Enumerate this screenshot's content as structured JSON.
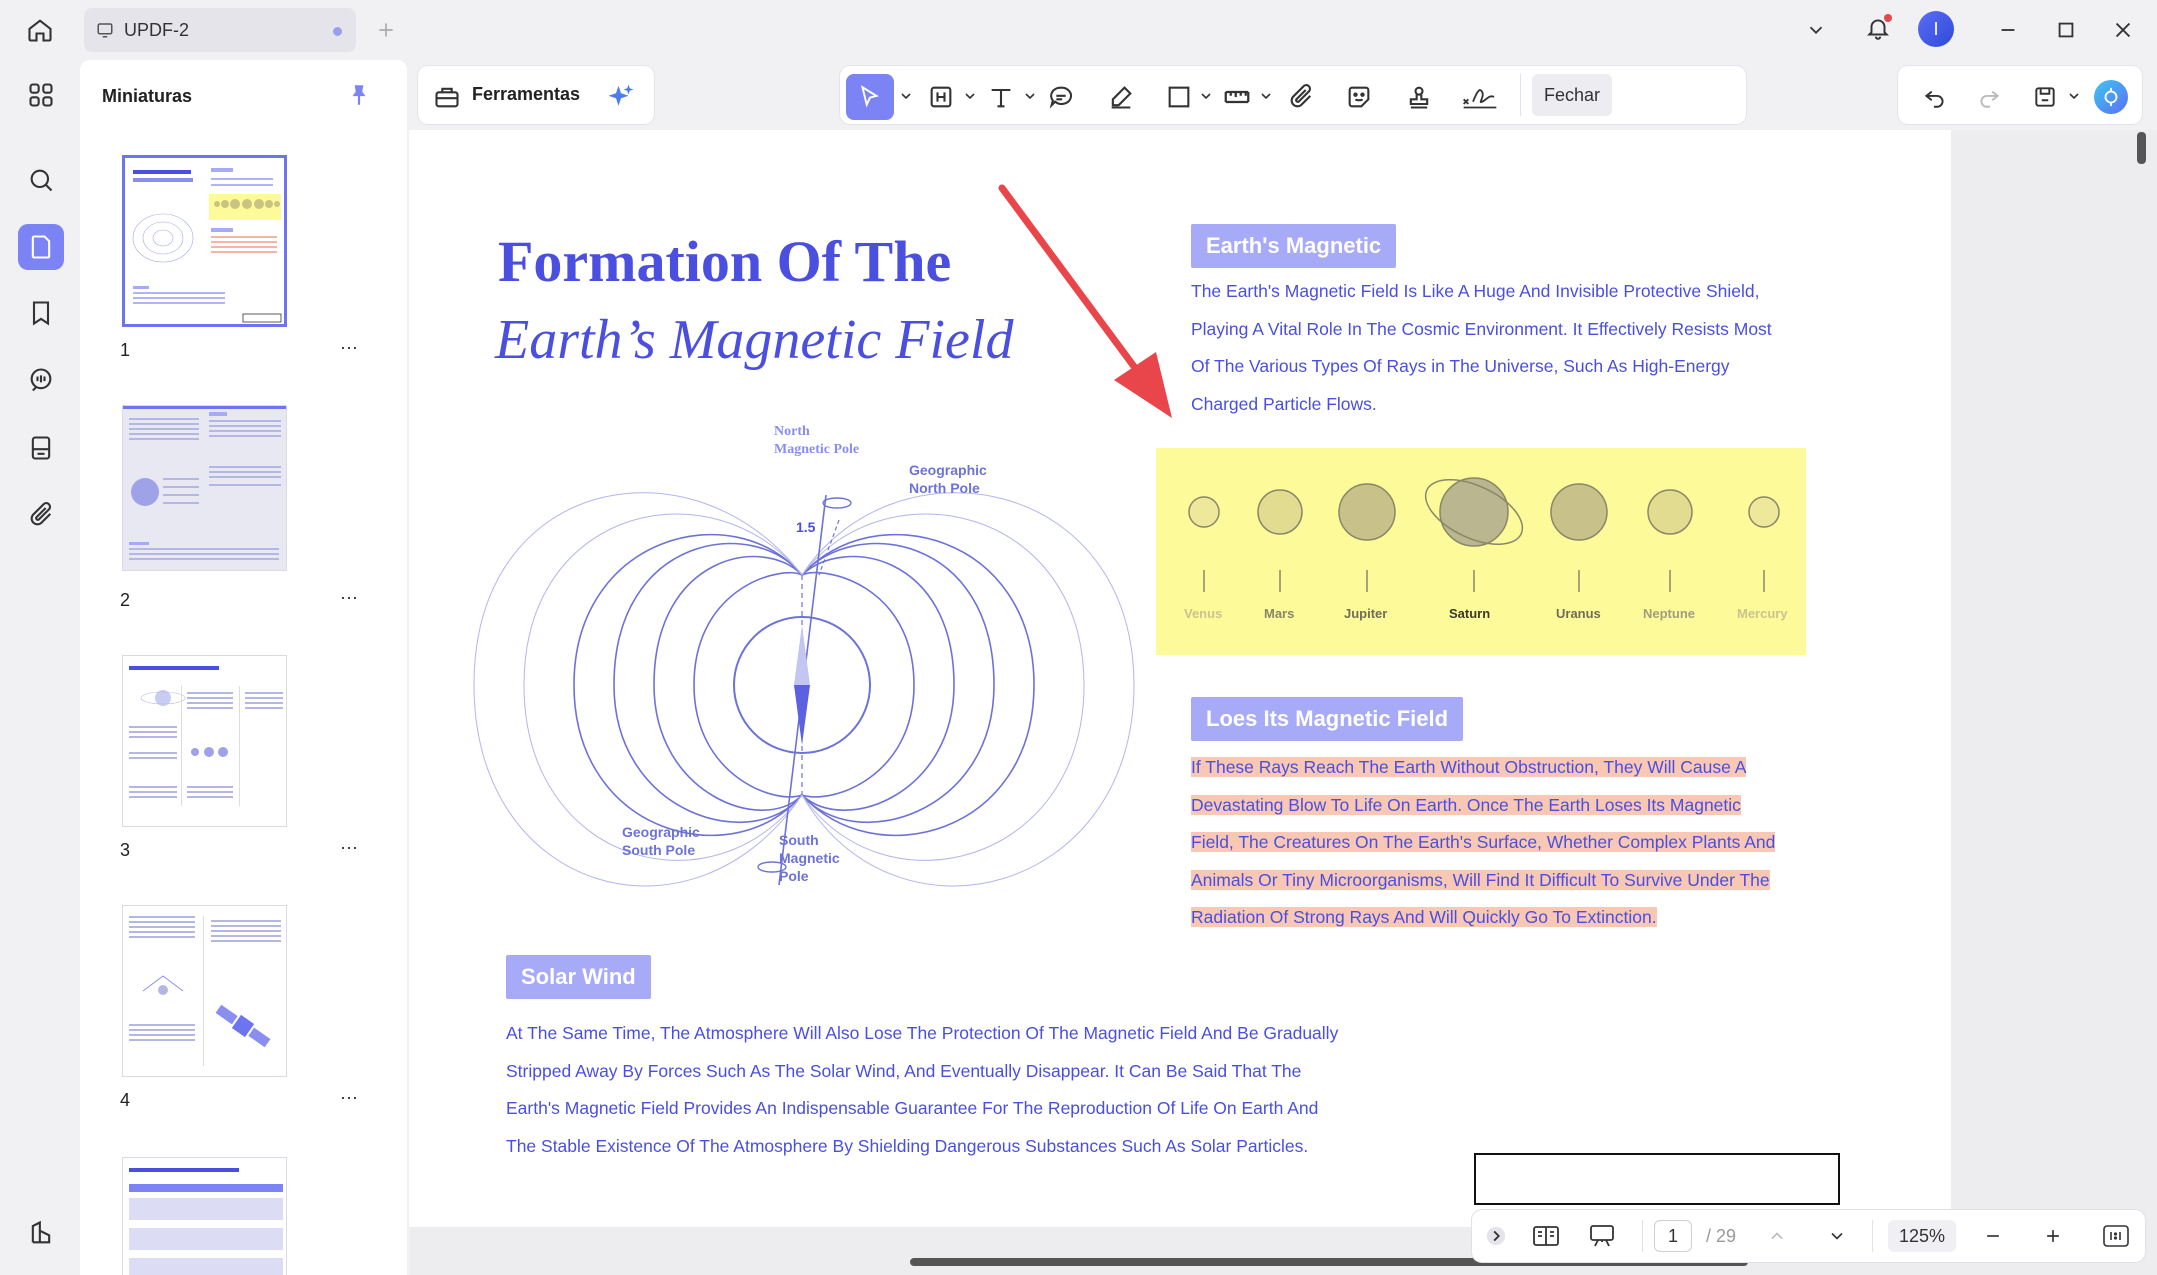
{
  "app": {
    "tab_title": "UPDF-2",
    "avatar_letter": "I"
  },
  "sidebar": {
    "title": "Miniaturas",
    "pages": [
      {
        "num": "1"
      },
      {
        "num": "2"
      },
      {
        "num": "3"
      },
      {
        "num": "4"
      }
    ],
    "more": "⋯"
  },
  "toolbar": {
    "tools_label": "Ferramentas",
    "close_label": "Fechar"
  },
  "document": {
    "title_line1": "Formation Of The",
    "title_line2": "Earth’s Magnetic Field",
    "section1": {
      "heading": "Earth's Magnetic",
      "lines": [
        "The Earth's Magnetic Field Is Like A Huge And Invisible Protective Shield,",
        "Playing A Vital Role In The Cosmic Environment. It Effectively Resists Most",
        "Of The Various Types Of Rays in The Universe, Such As High-Energy",
        "Charged Particle Flows."
      ]
    },
    "planets": [
      "Venus",
      "Mars",
      "Jupiter",
      "Saturn",
      "Uranus",
      "Neptune",
      "Mercury"
    ],
    "diagram": {
      "north_magnetic": [
        "North",
        "Magnetic Pole"
      ],
      "geo_north": [
        "Geographic",
        "North Pole"
      ],
      "geo_south": [
        "Geographic",
        "South Pole"
      ],
      "south_magnetic": [
        "South",
        "Magnetic",
        "Pole"
      ],
      "angle": "1.5"
    },
    "section2": {
      "heading": "Loes Its Magnetic Field",
      "lines": [
        "If These Rays Reach The Earth Without Obstruction, They Will Cause A",
        "Devastating Blow To Life On Earth. Once The Earth Loses Its Magnetic",
        "Field, The Creatures On The Earth's Surface, Whether Complex Plants And",
        "Animals Or Tiny Microorganisms, Will Find It Difficult To Survive Under The",
        "Radiation Of Strong Rays And Will Quickly Go To Extinction."
      ]
    },
    "section3": {
      "heading": "Solar Wind",
      "lines": [
        "At The Same Time, The Atmosphere Will Also Lose The Protection Of The Magnetic Field And Be Gradually",
        "Stripped Away By Forces Such As The Solar Wind, And Eventually Disappear. It Can Be Said That The",
        "Earth's Magnetic Field Provides An Indispensable Guarantee For The Reproduction Of Life On Earth And",
        "The Stable Existence Of The Atmosphere By Shielding Dangerous Substances Such As Solar Particles."
      ]
    }
  },
  "pager": {
    "current": "1",
    "total": "/ 29",
    "zoom": "125%"
  },
  "colors": {
    "accent": "#7b83f5",
    "doc_blue": "#4a4fe0",
    "highlight_yellow": "#fdfa9a",
    "highlight_orange": "#f8c8b4",
    "arrow_red": "#e8464a"
  }
}
